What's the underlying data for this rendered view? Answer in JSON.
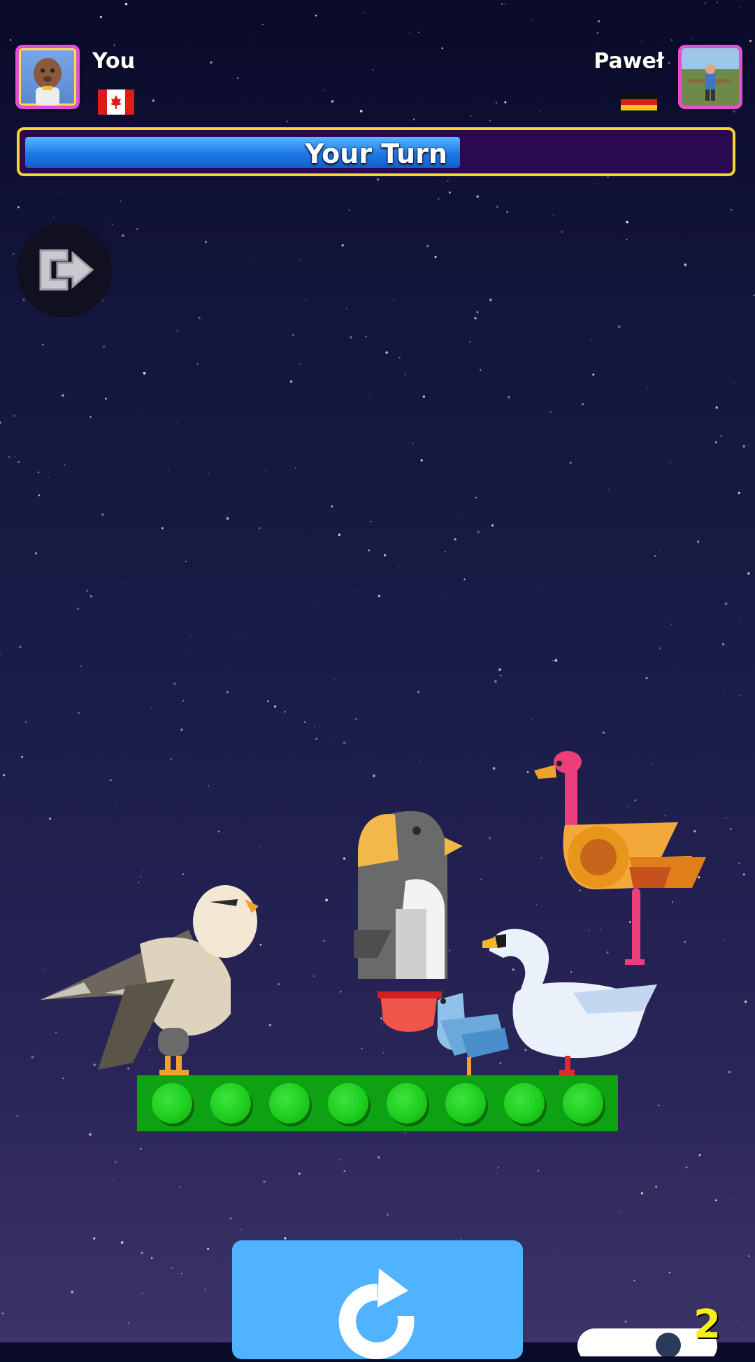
{
  "players": {
    "you": {
      "name": "You",
      "flag": "canada-flag-icon"
    },
    "opponent": {
      "name": "Paweł",
      "flag": "germany-flag-icon"
    }
  },
  "turn": {
    "label": "Your Turn",
    "timer_remaining_fraction": 0.62
  },
  "controls": {
    "exit_icon": "exit-icon",
    "rotate_icon": "rotate-icon",
    "counter_value": "2"
  },
  "board": {
    "platform_pegs": 8,
    "stacked_birds": [
      "eagle",
      "penguin",
      "pelican",
      "swan",
      "ostrich"
    ]
  },
  "colors": {
    "platform_green": "#0fa114",
    "turn_bar_border": "#f2d92a",
    "turn_bar_fill": "#1e78e6",
    "rotate_button": "#4fb3ff"
  }
}
